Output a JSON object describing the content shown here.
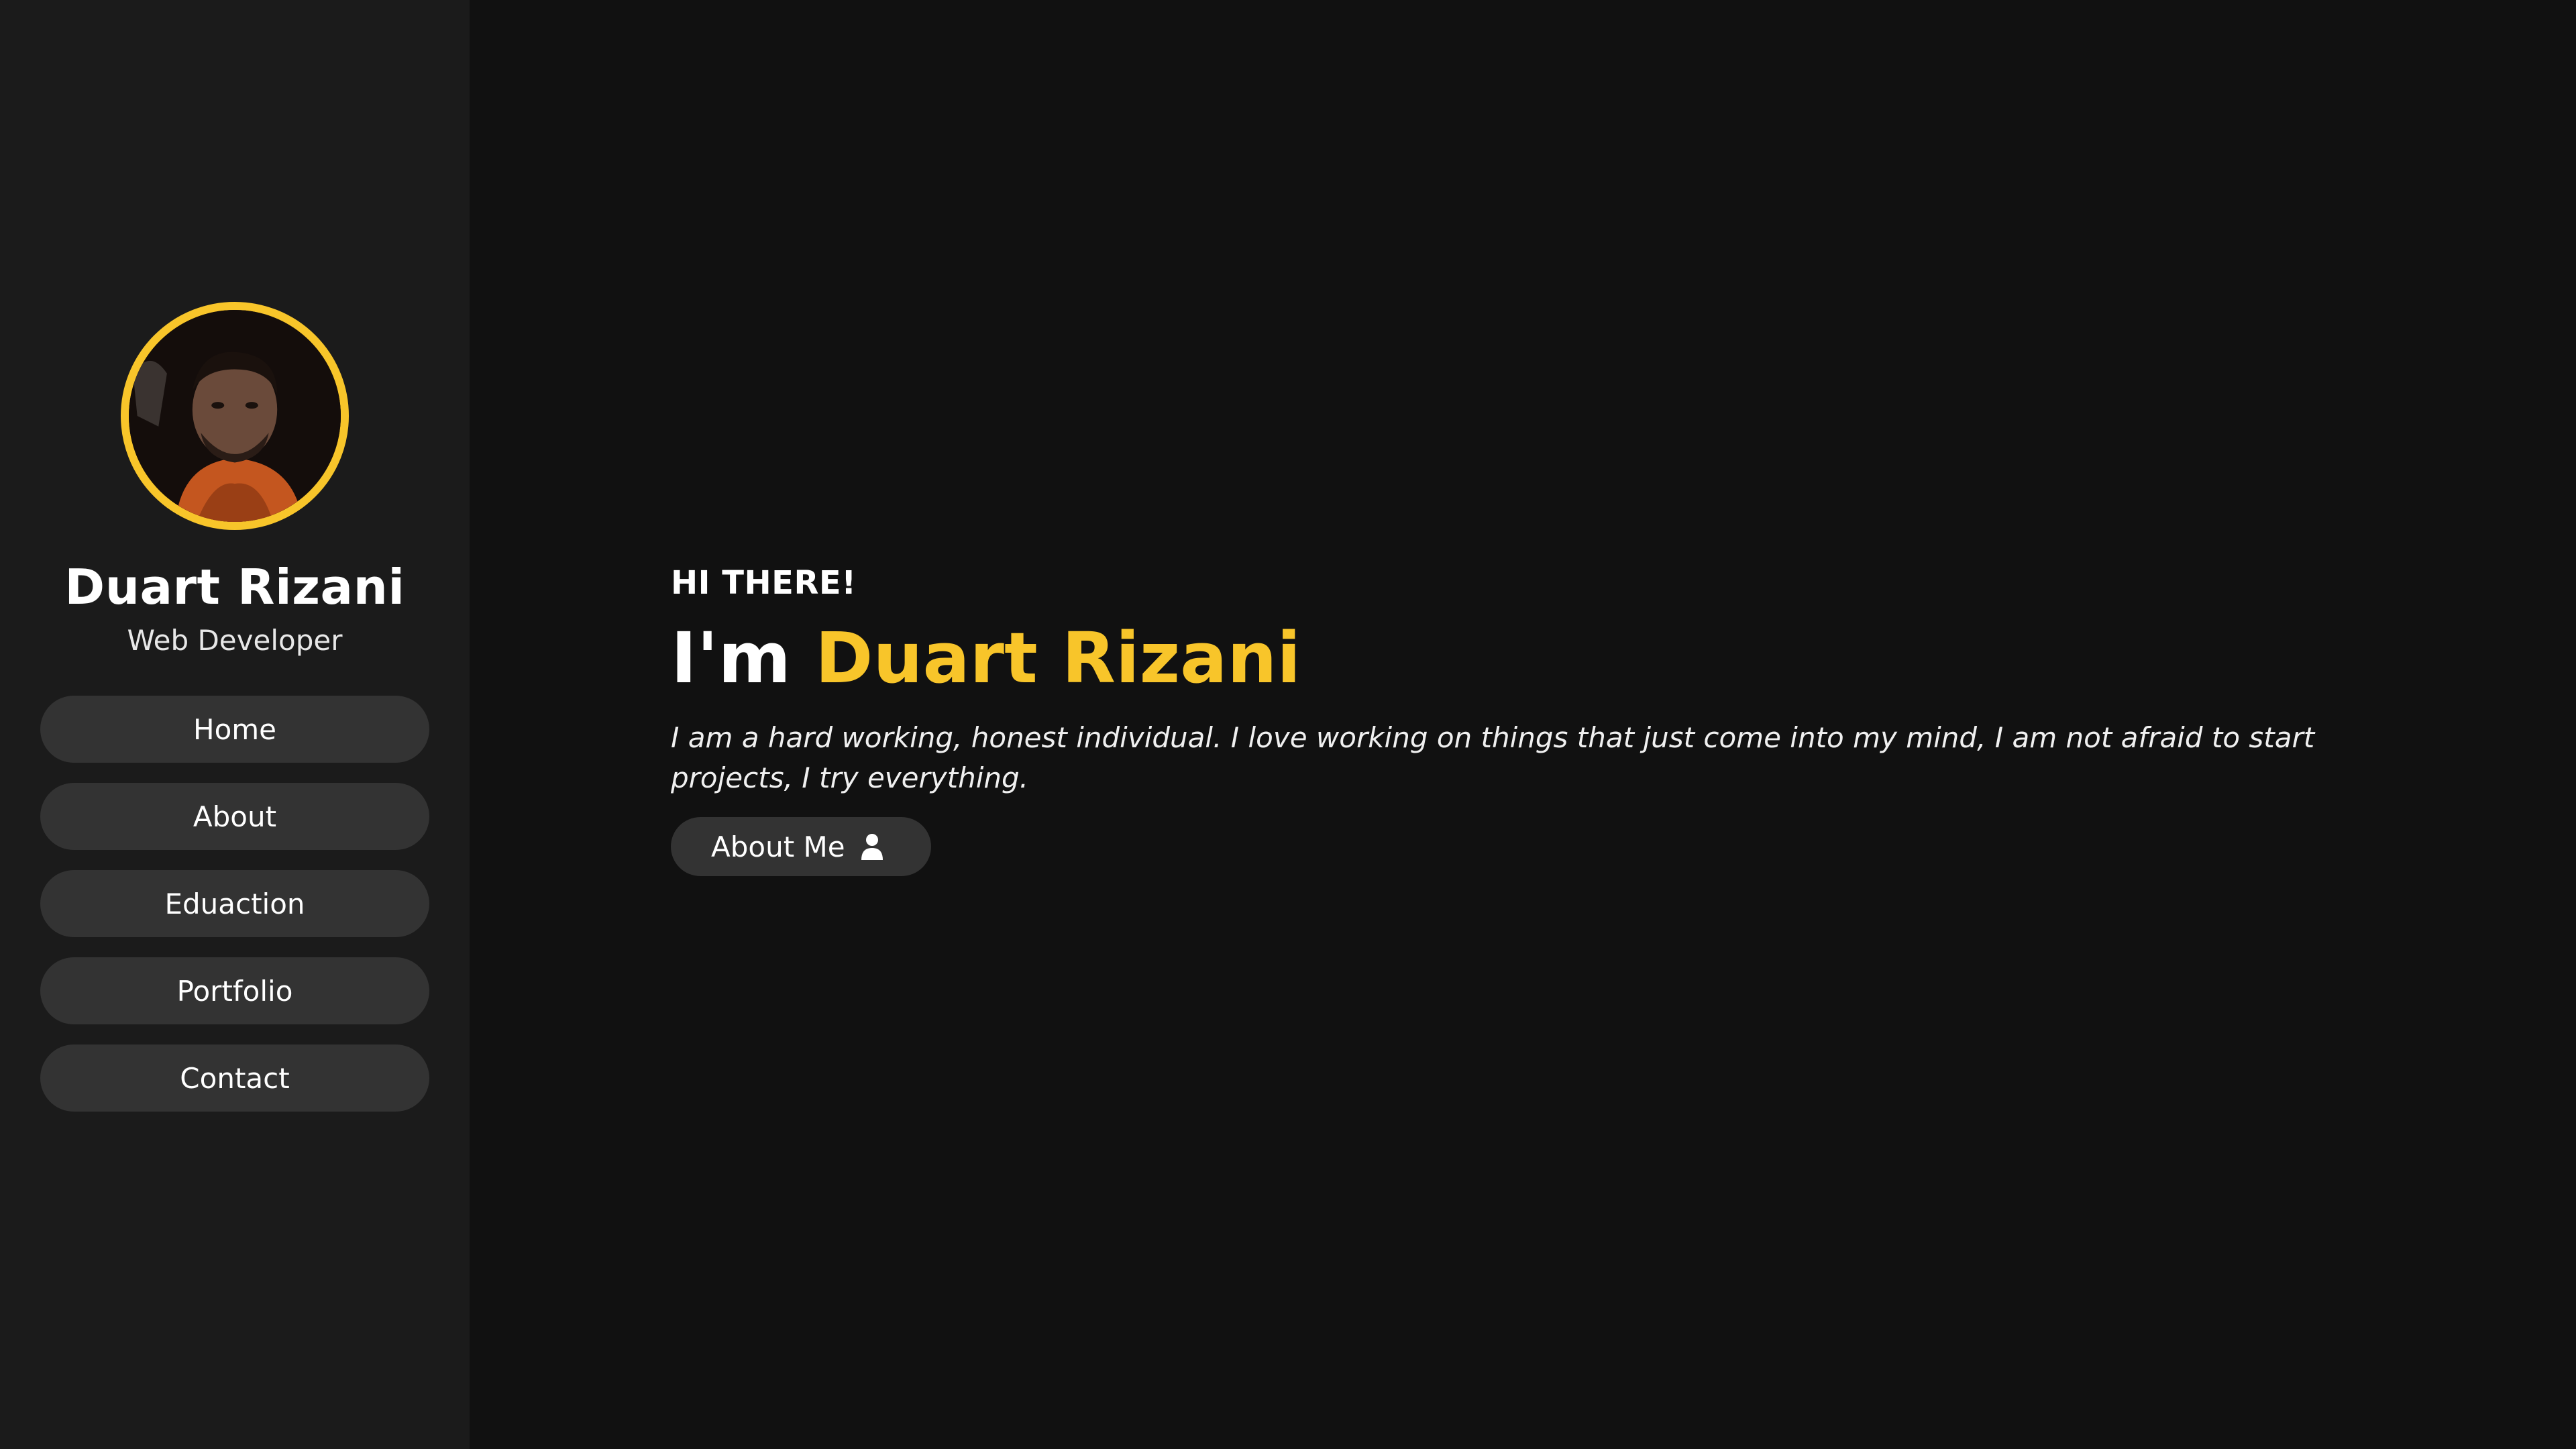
{
  "sidebar": {
    "name": "Duart Rizani",
    "role": "Web Developer",
    "nav": [
      {
        "label": "Home"
      },
      {
        "label": "About"
      },
      {
        "label": "Eduaction"
      },
      {
        "label": "Portfolio"
      },
      {
        "label": "Contact"
      }
    ]
  },
  "hero": {
    "greeting": "HI THERE!",
    "headline_prefix": "I'm",
    "headline_name": "Duart Rizani",
    "intro": "I am a hard working, honest individual. I love working on things that just come into my mind, I am not afraid to start projects, I try everything.",
    "button_label": "About Me",
    "button_icon": "user-icon"
  },
  "theme": {
    "accent": "#f8c52a",
    "sidebar_bg": "#1b1b1b",
    "page_bg": "#111111",
    "button_bg": "#333333"
  }
}
